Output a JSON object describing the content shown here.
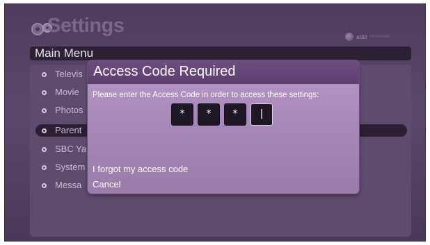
{
  "header": {
    "title": "Settings",
    "brand_name": "at&t",
    "brand_sub": "Homezone"
  },
  "main_menu": {
    "title": "Main Menu",
    "items": [
      {
        "label": "Televis"
      },
      {
        "label": "Movie"
      },
      {
        "label": "Photos"
      },
      {
        "label": "Parent"
      },
      {
        "label": "SBC Ya"
      },
      {
        "label": "System"
      },
      {
        "label": "Messa"
      }
    ],
    "highlighted_index": 3
  },
  "dialog": {
    "title": "Access Code Required",
    "message": "Please enter the Access Code in order to access these settings:",
    "code_boxes": [
      "*",
      "*",
      "*",
      "|"
    ],
    "forgot_label": "I forgot my access code",
    "cancel_label": "Cancel"
  },
  "colors": {
    "background": "#5b486a",
    "dialog": "#a586b6",
    "dialog_title_bar": "#5c3e70",
    "highlight_bar": "#2b1f33"
  }
}
